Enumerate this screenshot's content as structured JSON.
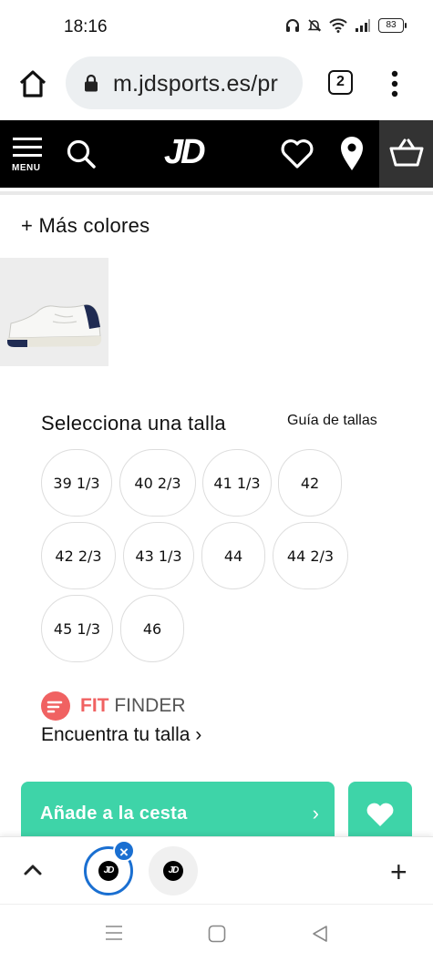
{
  "status": {
    "time": "18:16",
    "battery": "83"
  },
  "browser": {
    "url": "m.jdsports.es/pr",
    "tab_count": "2"
  },
  "header": {
    "menu_label": "MENU",
    "logo_text": "JD",
    "colors": {
      "background": "#000000",
      "basket_bg": "#333333"
    }
  },
  "product": {
    "more_colors": "+ Más colores",
    "size_title": "Selecciona una talla",
    "size_guide": "Guía de tallas",
    "sizes": [
      "39 1/3",
      "40 2/3",
      "41 1/3",
      "42",
      "42 2/3",
      "43 1/3",
      "44",
      "44 2/3",
      "45 1/3",
      "46"
    ]
  },
  "fit_finder": {
    "brand_fit": "FIT",
    "brand_finder": " FINDER",
    "link": "Encuentra tu talla ›",
    "color": "#f06262"
  },
  "actions": {
    "add_to_cart": "Añade a la cesta",
    "arrow": "›",
    "accent": "#3ed4a8"
  },
  "tab_strip": {
    "close_symbol": "×",
    "new_tab_symbol": "+",
    "tab_logo": "JD"
  }
}
